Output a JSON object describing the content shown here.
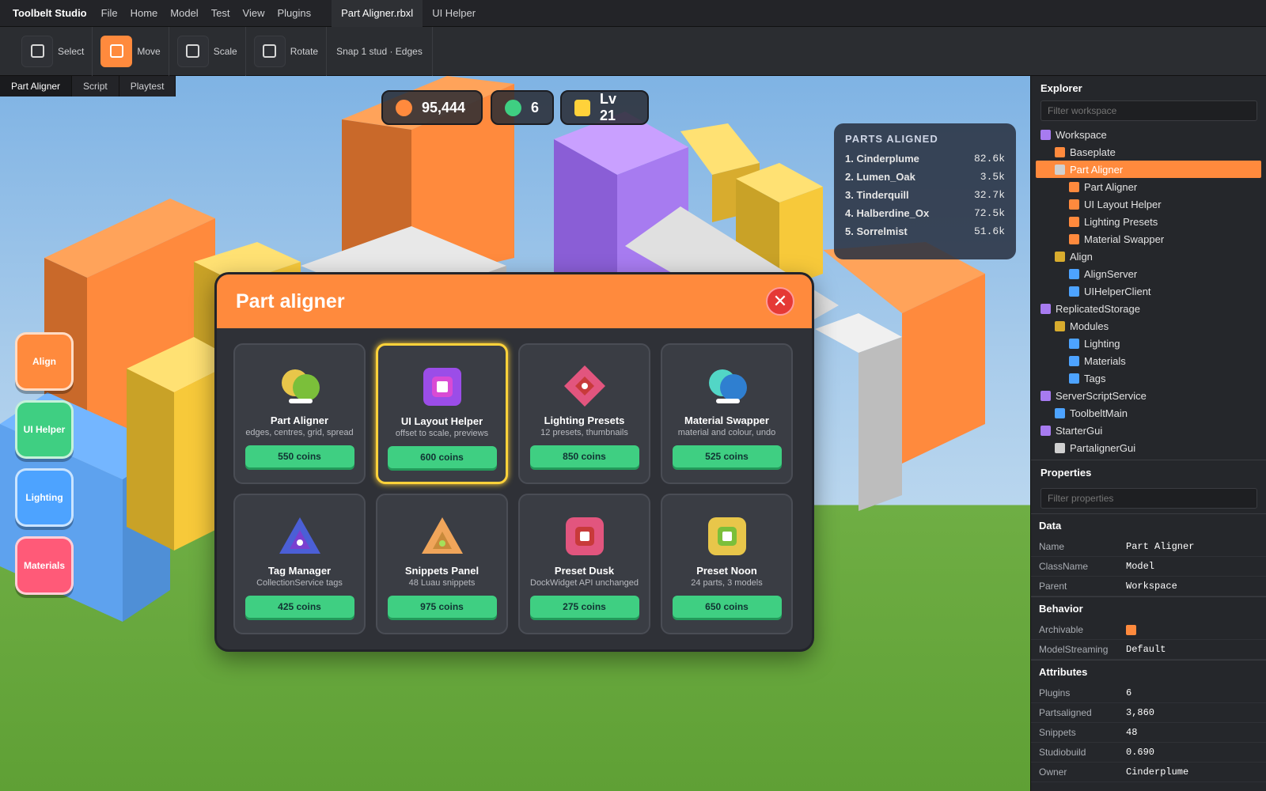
{
  "menubar": {
    "brand": "Toolbelt Studio",
    "items": [
      "File",
      "Home",
      "Model",
      "Test",
      "View",
      "Plugins"
    ],
    "tabs": [
      "Part Aligner.rbxl",
      "UI Helper"
    ]
  },
  "toolbar": {
    "tools": [
      "Select",
      "Move",
      "Scale",
      "Rotate"
    ],
    "snap": "Snap 1 stud · Edges"
  },
  "viewport_tabs": [
    "Part Aligner",
    "Script",
    "Playtest"
  ],
  "hud": {
    "coins": "95,444",
    "gems": "6",
    "level": "Lv 21"
  },
  "leaderboard": {
    "title": "PARTS ALIGNED",
    "rows": [
      {
        "name": "1. Cinderplume",
        "value": "82.6k"
      },
      {
        "name": "2. Lumen_Oak",
        "value": "3.5k"
      },
      {
        "name": "3. Tinderquill",
        "value": "32.7k"
      },
      {
        "name": "4. Halberdine_Ox",
        "value": "72.5k"
      },
      {
        "name": "5. Sorrelmist",
        "value": "51.6k"
      }
    ]
  },
  "side_buttons": [
    "Align",
    "UI Helper",
    "Lighting",
    "Materials"
  ],
  "modal": {
    "title": "Part aligner",
    "close": "✕",
    "cards": [
      {
        "name": "Part Aligner",
        "sub": "edges, centres, grid, spread",
        "price": "550 coins"
      },
      {
        "name": "UI Layout Helper",
        "sub": "offset to scale, previews",
        "price": "600 coins"
      },
      {
        "name": "Lighting Presets",
        "sub": "12 presets, thumbnails",
        "price": "850 coins"
      },
      {
        "name": "Material Swapper",
        "sub": "material and colour, undo",
        "price": "525 coins"
      },
      {
        "name": "Tag Manager",
        "sub": "CollectionService tags",
        "price": "425 coins"
      },
      {
        "name": "Snippets Panel",
        "sub": "48 Luau snippets",
        "price": "975 coins"
      },
      {
        "name": "Preset Dusk",
        "sub": "DockWidget API unchanged",
        "price": "275 coins"
      },
      {
        "name": "Preset Noon",
        "sub": "24 parts, 3 models",
        "price": "650 coins"
      }
    ]
  },
  "explorer": {
    "title": "Explorer",
    "filter_placeholder": "Filter workspace",
    "items": [
      {
        "label": "Workspace"
      },
      {
        "label": "Baseplate"
      },
      {
        "label": "Part Aligner"
      },
      {
        "label": "Part Aligner"
      },
      {
        "label": "UI Layout Helper"
      },
      {
        "label": "Lighting Presets"
      },
      {
        "label": "Material Swapper"
      },
      {
        "label": "Align"
      },
      {
        "label": "AlignServer"
      },
      {
        "label": "UIHelperClient"
      },
      {
        "label": "ReplicatedStorage"
      },
      {
        "label": "Modules"
      },
      {
        "label": "Lighting"
      },
      {
        "label": "Materials"
      },
      {
        "label": "Tags"
      },
      {
        "label": "ServerScriptService"
      },
      {
        "label": "ToolbeltMain"
      },
      {
        "label": "StarterGui"
      },
      {
        "label": "PartalignerGui"
      }
    ]
  },
  "properties": {
    "title": "Properties",
    "filter_placeholder": "Filter properties",
    "data_header": "Data",
    "behavior_header": "Behavior",
    "attributes_header": "Attributes",
    "data": [
      {
        "k": "Name",
        "v": "Part Aligner"
      },
      {
        "k": "ClassName",
        "v": "Model"
      },
      {
        "k": "Parent",
        "v": "Workspace"
      }
    ],
    "behavior": [
      {
        "k": "Archivable",
        "v": ""
      },
      {
        "k": "ModelStreaming",
        "v": "Default"
      }
    ],
    "attributes": [
      {
        "k": "Plugins",
        "v": "6"
      },
      {
        "k": "Partsaligned",
        "v": "3,860"
      },
      {
        "k": "Snippets",
        "v": "48"
      },
      {
        "k": "Studiobuild",
        "v": "0.690"
      },
      {
        "k": "Owner",
        "v": "Cinderplume"
      }
    ]
  },
  "colors": {
    "accent": "#ff8a3d",
    "price_green": "#3fcf82",
    "selected_border": "#ffd23a",
    "close_red": "#e53935"
  }
}
